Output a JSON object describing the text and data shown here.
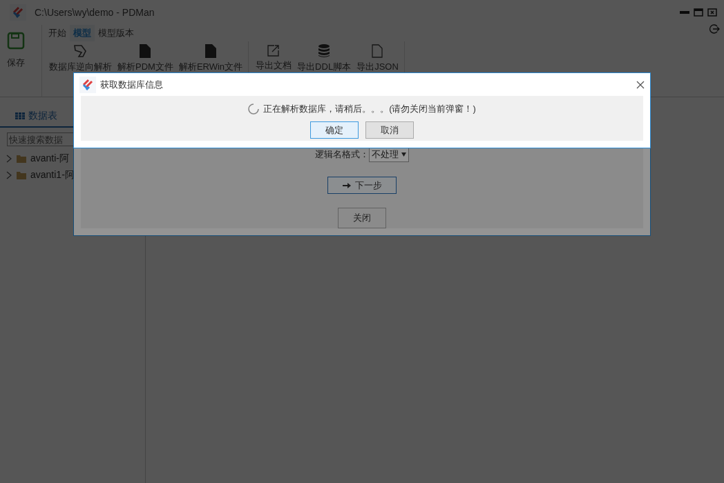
{
  "window": {
    "title": "C:\\Users\\wy\\demo - PDMan"
  },
  "menu_tabs": [
    {
      "label": "开始",
      "selected": false
    },
    {
      "label": "模型",
      "selected": true
    },
    {
      "label": "模型版本",
      "selected": false
    }
  ],
  "toolbar": {
    "groups": [
      [
        {
          "label": "保存",
          "kind": "save"
        }
      ],
      [
        {
          "label": "数据库逆向解析",
          "kind": "reverse"
        },
        {
          "label": "解析PDM文件",
          "kind": "file"
        },
        {
          "label": "解析ERWin文件",
          "kind": "file"
        }
      ],
      [
        {
          "label": "导出文档",
          "kind": "export"
        },
        {
          "label": "导出DDL脚本",
          "kind": "database"
        },
        {
          "label": "导出JSON",
          "kind": "document"
        }
      ]
    ]
  },
  "sidebar": {
    "tabs": [
      {
        "label": "数据表",
        "selected": true
      }
    ],
    "search": {
      "placeholder": "快速搜索数据"
    },
    "tree": [
      {
        "label": "avanti-阿",
        "expanded": false
      },
      {
        "label": "avanti1-阿",
        "expanded": false
      }
    ]
  },
  "background_dialog": {
    "fields": [
      {
        "label": "逻辑名格式：",
        "value": "不处理"
      }
    ],
    "next_button": "下一步",
    "close_button": "关闭"
  },
  "dialog": {
    "title": "获取数据库信息",
    "message": "正在解析数据库，请稍后。。。(请勿关闭当前弹窗！)",
    "buttons": [
      {
        "label": "确定",
        "primary": true
      },
      {
        "label": "取消",
        "primary": false
      }
    ]
  }
}
